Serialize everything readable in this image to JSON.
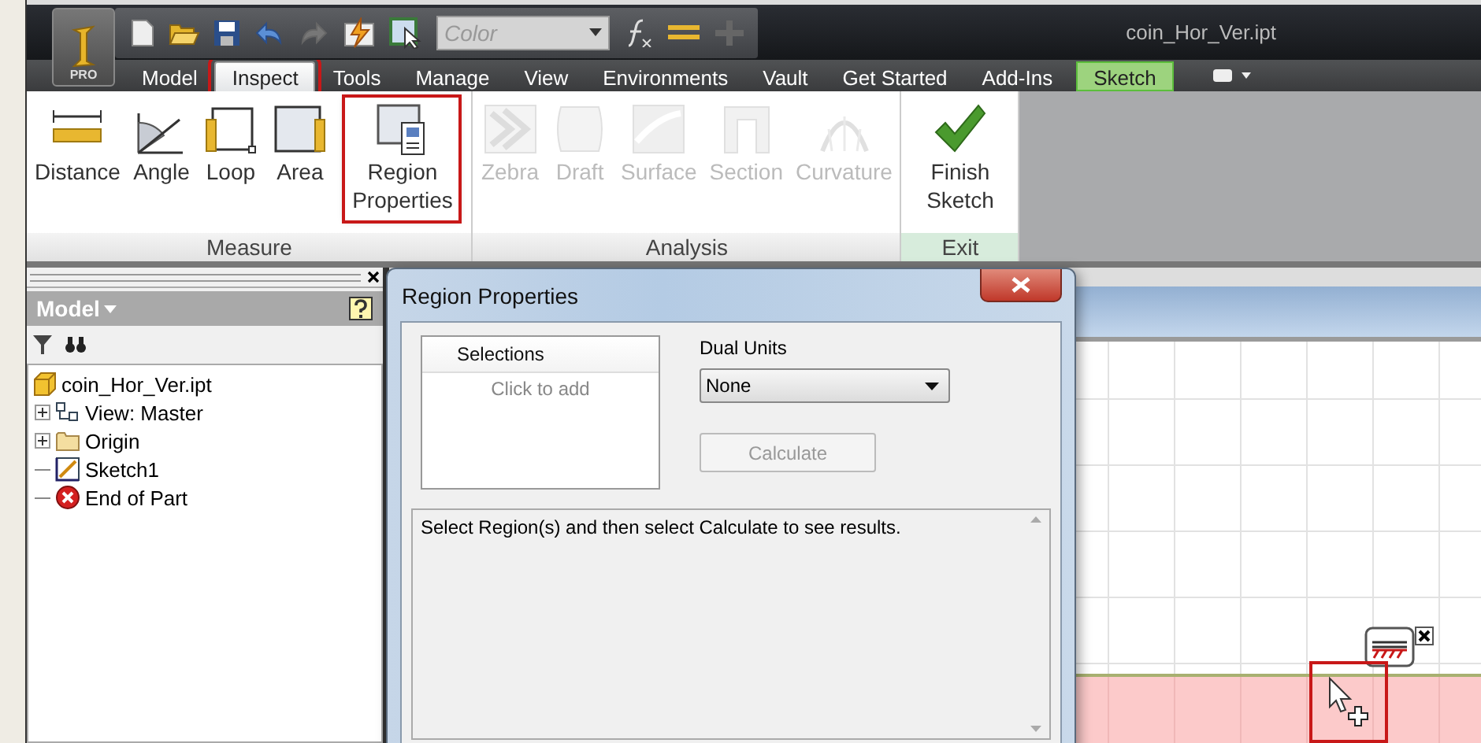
{
  "app": {
    "title": "coin_Hor_Ver.ipt",
    "edition": "PRO",
    "color_field": {
      "placeholder": "Color"
    }
  },
  "tabs": [
    {
      "label": "Model",
      "selected": false,
      "annotated": false,
      "kind": "normal"
    },
    {
      "label": "Inspect",
      "selected": true,
      "annotated": true,
      "kind": "normal"
    },
    {
      "label": "Tools",
      "selected": false,
      "annotated": false,
      "kind": "normal"
    },
    {
      "label": "Manage",
      "selected": false,
      "annotated": false,
      "kind": "normal"
    },
    {
      "label": "View",
      "selected": false,
      "annotated": false,
      "kind": "normal"
    },
    {
      "label": "Environments",
      "selected": false,
      "annotated": false,
      "kind": "normal"
    },
    {
      "label": "Vault",
      "selected": false,
      "annotated": false,
      "kind": "normal"
    },
    {
      "label": "Get Started",
      "selected": false,
      "annotated": false,
      "kind": "normal"
    },
    {
      "label": "Add-Ins",
      "selected": false,
      "annotated": false,
      "kind": "normal"
    },
    {
      "label": "Sketch",
      "selected": false,
      "annotated": false,
      "kind": "context"
    }
  ],
  "ribbon": {
    "panels": [
      {
        "label": "Measure",
        "kind": "normal",
        "buttons": [
          {
            "label": "Distance",
            "disabled": false,
            "annotated": false
          },
          {
            "label": "Angle",
            "disabled": false,
            "annotated": false
          },
          {
            "label": "Loop",
            "disabled": false,
            "annotated": false
          },
          {
            "label": "Area",
            "disabled": false,
            "annotated": false
          },
          {
            "label": "Region Properties",
            "disabled": false,
            "annotated": true
          }
        ]
      },
      {
        "label": "Analysis",
        "kind": "normal",
        "buttons": [
          {
            "label": "Zebra",
            "disabled": true,
            "annotated": false
          },
          {
            "label": "Draft",
            "disabled": true,
            "annotated": false
          },
          {
            "label": "Surface",
            "disabled": true,
            "annotated": false
          },
          {
            "label": "Section",
            "disabled": true,
            "annotated": false
          },
          {
            "label": "Curvature",
            "disabled": true,
            "annotated": false
          }
        ]
      },
      {
        "label": "Exit",
        "kind": "exit",
        "buttons": [
          {
            "label": "Finish Sketch",
            "disabled": false,
            "annotated": false
          }
        ]
      }
    ]
  },
  "browser": {
    "title": "Model",
    "tree": [
      {
        "label": "coin_Hor_Ver.ipt",
        "expandable": false,
        "children": [
          {
            "label": "View: Master",
            "expandable": true
          },
          {
            "label": "Origin",
            "expandable": true
          },
          {
            "label": "Sketch1",
            "expandable": false
          },
          {
            "label": "End of Part",
            "expandable": false
          }
        ]
      }
    ]
  },
  "dialog": {
    "title": "Region Properties",
    "selections": {
      "header": "Selections",
      "placeholder": "Click to add"
    },
    "dual_units": {
      "label": "Dual Units",
      "value": "None"
    },
    "calculate": {
      "label": "Calculate",
      "disabled": true
    },
    "results": "Select Region(s) and then select Calculate to see results."
  },
  "canvas": {
    "cursor_annotated": true
  }
}
